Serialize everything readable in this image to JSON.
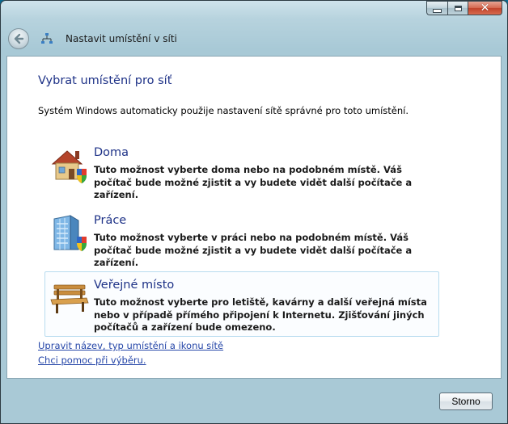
{
  "window": {
    "title": "Nastavit umístění v síti",
    "caption_buttons": [
      "minimize",
      "maximize",
      "close"
    ]
  },
  "content": {
    "heading": "Vybrat umístění pro síť",
    "intro": "Systém Windows automaticky použije nastavení sítě správné pro toto umístění.",
    "options": [
      {
        "icon": "home-icon",
        "title": "Doma",
        "description": "Tuto možnost vyberte doma nebo na podobném místě. Váš počítač bude možné zjistit a vy budete vidět další počítače a zařízení."
      },
      {
        "icon": "office-building-icon",
        "title": "Práce",
        "description": "Tuto možnost vyberte v práci nebo na podobném místě. Váš počítač bude možné zjistit a vy budete vidět další počítače a zařízení."
      },
      {
        "icon": "park-bench-icon",
        "title": "Veřejné místo",
        "description": "Tuto možnost vyberte pro letiště, kavárny a další veřejná místa nebo v případě přímého připojení k Internetu. Zjišťování jiných počítačů a zařízení bude omezeno."
      }
    ],
    "links": {
      "customize": "Upravit název, typ umístění a ikonu sítě",
      "help": "Chci pomoc při výběru."
    }
  },
  "footer": {
    "cancel_label": "Storno"
  }
}
